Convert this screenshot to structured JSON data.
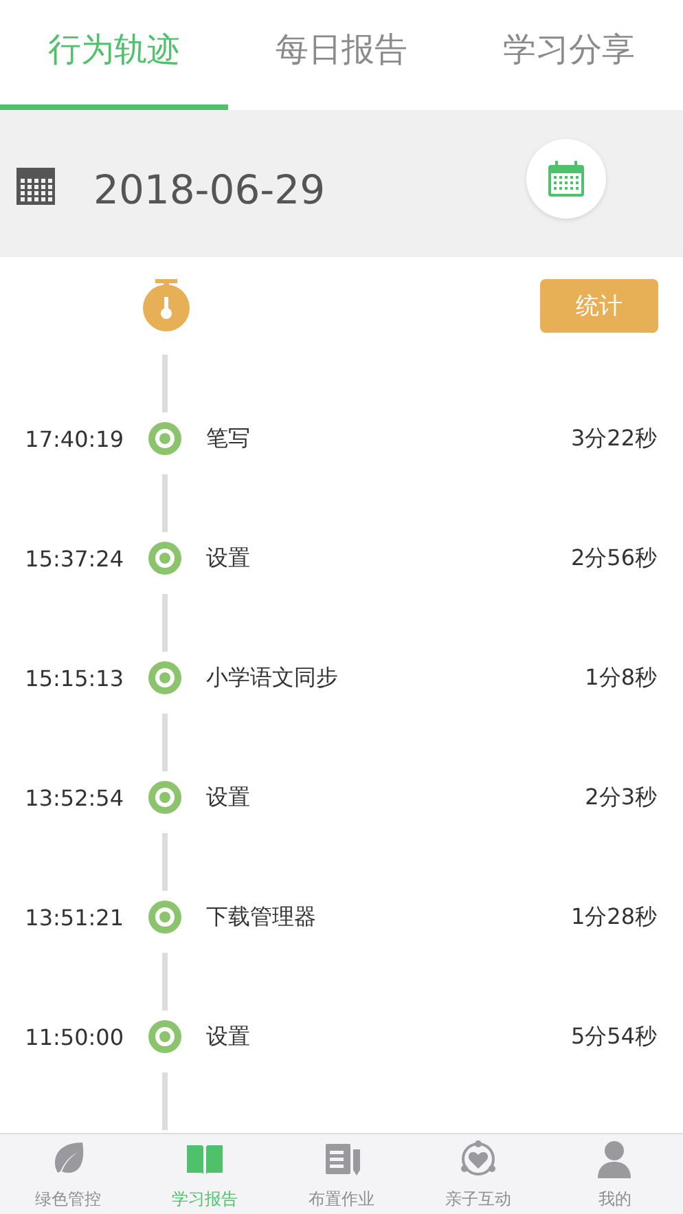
{
  "tabs": [
    {
      "label": "行为轨迹",
      "selected": true
    },
    {
      "label": "每日报告",
      "selected": false
    },
    {
      "label": "学习分享",
      "selected": false
    }
  ],
  "date_bar": {
    "date": "2018-06-29"
  },
  "stats_button": "统计",
  "timeline": [
    {
      "time": "17:40:19",
      "app": "笔写",
      "duration": "3分22秒"
    },
    {
      "time": "15:37:24",
      "app": "设置",
      "duration": "2分56秒"
    },
    {
      "time": "15:15:13",
      "app": "小学语文同步",
      "duration": "1分8秒"
    },
    {
      "time": "13:52:54",
      "app": "设置",
      "duration": "2分3秒"
    },
    {
      "time": "13:51:21",
      "app": "下载管理器",
      "duration": "1分28秒"
    },
    {
      "time": "11:50:00",
      "app": "设置",
      "duration": "5分54秒"
    }
  ],
  "bottom_nav": [
    {
      "label": "绿色管控",
      "kind": "leaf",
      "selected": false
    },
    {
      "label": "学习报告",
      "kind": "book",
      "selected": true
    },
    {
      "label": "布置作业",
      "kind": "homework",
      "selected": false
    },
    {
      "label": "亲子互动",
      "kind": "heart",
      "selected": false
    },
    {
      "label": "我的",
      "kind": "person",
      "selected": false
    }
  ]
}
